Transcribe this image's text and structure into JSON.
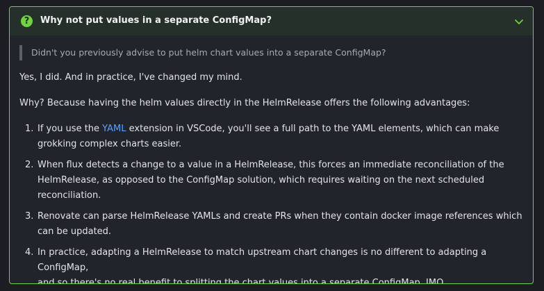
{
  "admonition": {
    "title": "Why not put values in a separate ConfigMap?",
    "quote": "Didn't you previously advise to put helm chart values into a separate ConfigMap?",
    "paragraph1": "Yes, I did. And in practice, I've changed my mind.",
    "paragraph2": "Why? Because having the helm values directly in the HelmRelease offers the following advantages:",
    "items": [
      {
        "num": "1.",
        "pre": "If you use the ",
        "link": "YAML",
        "post1": " extension in VSCode, you'll see a full path to the YAML elements, which can make",
        "post2": "grokking complex charts easier."
      },
      {
        "num": "2.",
        "line1": "When flux detects a change to a value in a HelmRelease, this forces an immediate reconciliation of the",
        "line2": "HelmRelease, as opposed to the ConfigMap solution, which requires waiting on the next scheduled",
        "line3": "reconciliation."
      },
      {
        "num": "3.",
        "line1": "Renovate can parse HelmRelease YAMLs and create PRs when they contain docker image references which",
        "line2": "can be updated."
      },
      {
        "num": "4.",
        "line1": "In practice, adapting a HelmRelease to match upstream chart changes is no different to adapting a ConfigMap,",
        "line2": "and so there's no real benefit to splitting the chart values into a separate ConfigMap, IMO."
      }
    ]
  },
  "icons": {
    "question": "question-circle-icon",
    "chevron": "chevron-down-icon"
  },
  "colors": {
    "accent": "#6cd24a",
    "link": "#5aa0ff",
    "background": "#21242b"
  }
}
